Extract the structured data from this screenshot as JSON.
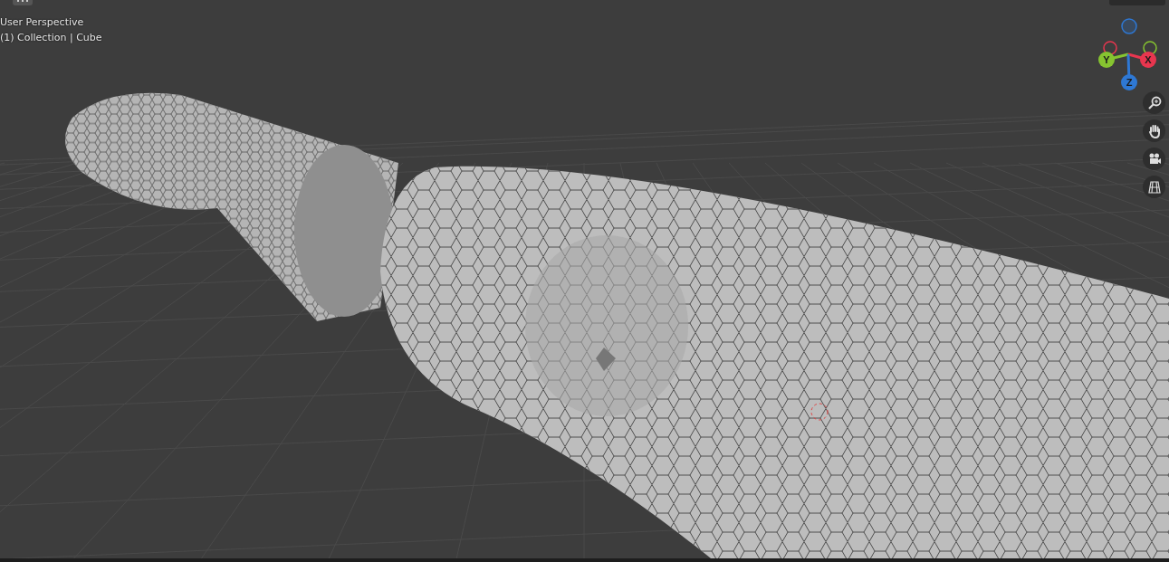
{
  "viewport": {
    "view_name": "User Perspective",
    "object_info": "(1) Collection | Cube",
    "gizmo_axes": [
      {
        "label": "Y",
        "color": "#86c430",
        "kind": "positive"
      },
      {
        "label": "X",
        "color": "#e8364f",
        "kind": "positive"
      },
      {
        "label": "Z",
        "color": "#2e78d4",
        "kind": "positive"
      },
      {
        "color": "#e8364f",
        "kind": "negative"
      }
    ],
    "nav_buttons": [
      {
        "kind": "zoom"
      },
      {
        "kind": "pan"
      },
      {
        "kind": "camera"
      },
      {
        "kind": "ortho"
      }
    ]
  }
}
